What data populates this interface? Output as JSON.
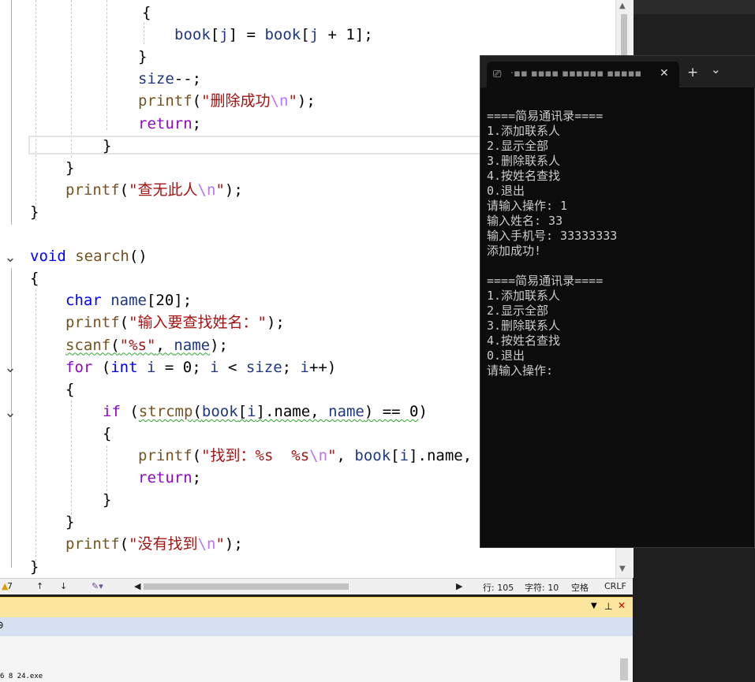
{
  "editor": {
    "lines": [
      [
        {
          "t": "{",
          "c": ""
        }
      ],
      [
        {
          "t": "book",
          "c": "var"
        },
        {
          "t": "[",
          "c": ""
        },
        {
          "t": "j",
          "c": "var"
        },
        {
          "t": "] = ",
          "c": ""
        },
        {
          "t": "book",
          "c": "var"
        },
        {
          "t": "[",
          "c": ""
        },
        {
          "t": "j",
          "c": "var"
        },
        {
          "t": " + 1];",
          "c": ""
        }
      ],
      [
        {
          "t": "}",
          "c": ""
        }
      ],
      [
        {
          "t": "size",
          "c": "var"
        },
        {
          "t": "--;",
          "c": ""
        }
      ],
      [
        {
          "t": "printf",
          "c": "fn"
        },
        {
          "t": "(",
          "c": ""
        },
        {
          "t": "\"删除成功",
          "c": "str"
        },
        {
          "t": "\\n",
          "c": "esc"
        },
        {
          "t": "\"",
          "c": "str"
        },
        {
          "t": ");",
          "c": ""
        }
      ],
      [
        {
          "t": "return",
          "c": "kw2"
        },
        {
          "t": ";",
          "c": ""
        }
      ],
      [
        {
          "t": "}",
          "c": ""
        }
      ],
      [
        {
          "t": "}",
          "c": ""
        }
      ],
      [
        {
          "t": "printf",
          "c": "fn"
        },
        {
          "t": "(",
          "c": ""
        },
        {
          "t": "\"查无此人",
          "c": "str"
        },
        {
          "t": "\\n",
          "c": "esc"
        },
        {
          "t": "\"",
          "c": "str"
        },
        {
          "t": ");",
          "c": ""
        }
      ],
      [
        {
          "t": "}",
          "c": ""
        }
      ],
      [],
      [
        {
          "t": "void",
          "c": "kw"
        },
        {
          "t": " ",
          "c": ""
        },
        {
          "t": "search",
          "c": "fn"
        },
        {
          "t": "()",
          "c": ""
        }
      ],
      [
        {
          "t": "{",
          "c": ""
        }
      ],
      [
        {
          "t": "char",
          "c": "kw"
        },
        {
          "t": " ",
          "c": ""
        },
        {
          "t": "name",
          "c": "var"
        },
        {
          "t": "[20];",
          "c": ""
        }
      ],
      [
        {
          "t": "printf",
          "c": "fn"
        },
        {
          "t": "(",
          "c": ""
        },
        {
          "t": "\"输入要查找姓名：\"",
          "c": "str"
        },
        {
          "t": ");",
          "c": ""
        }
      ],
      [
        {
          "t": "scanf",
          "c": "fn squig"
        },
        {
          "t": "(",
          "c": "squig"
        },
        {
          "t": "\"%s\"",
          "c": "str squig"
        },
        {
          "t": ", ",
          "c": "squig"
        },
        {
          "t": "name",
          "c": "var squig"
        },
        {
          "t": ");",
          "c": ""
        }
      ],
      [
        {
          "t": "for",
          "c": "kw2"
        },
        {
          "t": " (",
          "c": ""
        },
        {
          "t": "int",
          "c": "kw"
        },
        {
          "t": " ",
          "c": ""
        },
        {
          "t": "i",
          "c": "var"
        },
        {
          "t": " = 0; ",
          "c": ""
        },
        {
          "t": "i",
          "c": "var"
        },
        {
          "t": " < ",
          "c": ""
        },
        {
          "t": "size",
          "c": "var"
        },
        {
          "t": "; ",
          "c": ""
        },
        {
          "t": "i",
          "c": "var"
        },
        {
          "t": "++)",
          "c": ""
        }
      ],
      [
        {
          "t": "{",
          "c": ""
        }
      ],
      [
        {
          "t": "if",
          "c": "kw2"
        },
        {
          "t": " (",
          "c": ""
        },
        {
          "t": "strcmp",
          "c": "fn squig"
        },
        {
          "t": "(",
          "c": "squig"
        },
        {
          "t": "book",
          "c": "var squig"
        },
        {
          "t": "[",
          "c": "squig"
        },
        {
          "t": "i",
          "c": "var squig"
        },
        {
          "t": "].name, ",
          "c": "squig"
        },
        {
          "t": "name",
          "c": "var squig"
        },
        {
          "t": ") == 0",
          "c": "squig"
        },
        {
          "t": ")",
          "c": ""
        }
      ],
      [
        {
          "t": "{",
          "c": ""
        }
      ],
      [
        {
          "t": "printf",
          "c": "fn"
        },
        {
          "t": "(",
          "c": ""
        },
        {
          "t": "\"找到：%s  %s",
          "c": "str"
        },
        {
          "t": "\\n",
          "c": "esc"
        },
        {
          "t": "\"",
          "c": "str"
        },
        {
          "t": ", ",
          "c": ""
        },
        {
          "t": "book",
          "c": "var"
        },
        {
          "t": "[",
          "c": ""
        },
        {
          "t": "i",
          "c": "var"
        },
        {
          "t": "].name,",
          "c": ""
        }
      ],
      [
        {
          "t": "return",
          "c": "kw2"
        },
        {
          "t": ";",
          "c": ""
        }
      ],
      [
        {
          "t": "}",
          "c": ""
        }
      ],
      [
        {
          "t": "}",
          "c": ""
        }
      ],
      [
        {
          "t": "printf",
          "c": "fn"
        },
        {
          "t": "(",
          "c": ""
        },
        {
          "t": "\"没有找到",
          "c": "str"
        },
        {
          "t": "\\n",
          "c": "esc"
        },
        {
          "t": "\"",
          "c": "str"
        },
        {
          "t": ");",
          "c": ""
        }
      ],
      [
        {
          "t": "}",
          "c": ""
        }
      ]
    ]
  },
  "statusbar": {
    "zoom": "7",
    "line": "行: 105",
    "col": "字符: 10",
    "spaces": "空格",
    "eol": "CRLF"
  },
  "output_panel": {
    "bottom_text": "6 8 24.exe"
  },
  "terminal": {
    "tab_title": "·▪▪ ▪▪▪▪ ▪▪▪▪▪▪ ▪▪▪▪▪",
    "close_glyph": "✕",
    "new_tab_glyph": "+",
    "dropdown_glyph": "⌄",
    "lines": [
      "====简易通讯录====",
      "1.添加联系人",
      "2.显示全部",
      "3.删除联系人",
      "4.按姓名查找",
      "0.退出",
      "请输入操作: 1",
      "输入姓名: 33",
      "输入手机号: 33333333",
      "添加成功!",
      "",
      "====简易通讯录====",
      "1.添加联系人",
      "2.显示全部",
      "3.删除联系人",
      "4.按姓名查找",
      "0.退出",
      "请输入操作:"
    ]
  }
}
